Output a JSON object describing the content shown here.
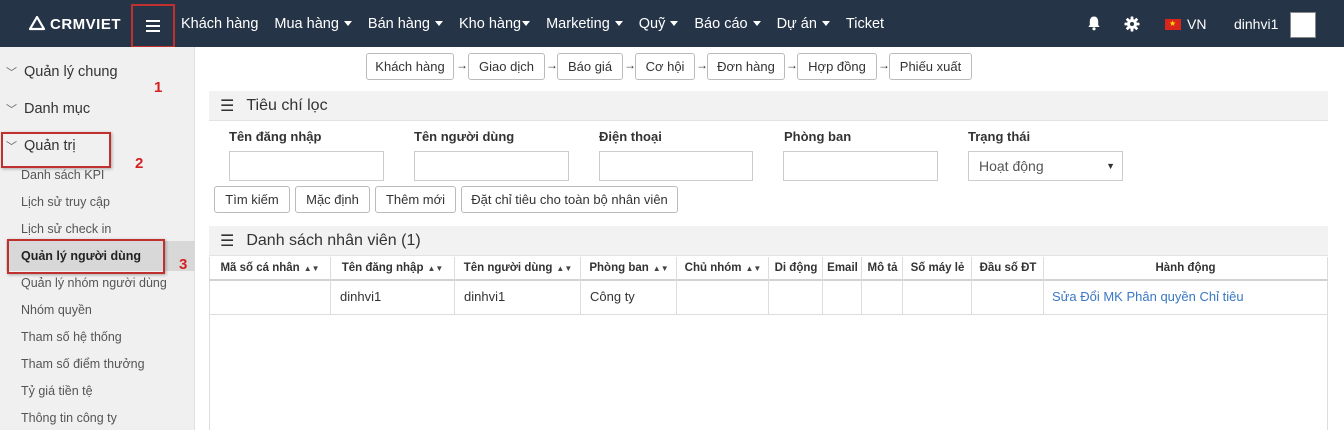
{
  "brand": {
    "name": "CRMVIET"
  },
  "nav": {
    "items": [
      {
        "label": "Khách hàng",
        "dropdown": false
      },
      {
        "label": "Mua hàng",
        "dropdown": true
      },
      {
        "label": "Bán hàng",
        "dropdown": true
      },
      {
        "label": "Kho hàng",
        "dropdown": true
      },
      {
        "label": "Marketing",
        "dropdown": true
      },
      {
        "label": "Quỹ",
        "dropdown": true
      },
      {
        "label": "Báo cáo",
        "dropdown": true
      },
      {
        "label": "Dự án",
        "dropdown": true
      },
      {
        "label": "Ticket",
        "dropdown": false
      }
    ],
    "language": "VN",
    "username": "dinhvi1"
  },
  "sidebar": {
    "groups": [
      {
        "label": "Quản lý chung"
      },
      {
        "label": "Danh mục"
      },
      {
        "label": "Quản trị"
      }
    ],
    "sub_items": [
      {
        "label": "Danh sách KPI"
      },
      {
        "label": "Lịch sử truy cập"
      },
      {
        "label": "Lịch sử check in"
      },
      {
        "label": "Quản lý người dùng",
        "active": true
      },
      {
        "label": "Quản lý nhóm người dùng"
      },
      {
        "label": "Nhóm quyền"
      },
      {
        "label": "Tham số hệ thống"
      },
      {
        "label": "Tham số điểm thưởng"
      },
      {
        "label": "Tỷ giá tiền tệ"
      },
      {
        "label": "Thông tin công ty"
      }
    ]
  },
  "annotations": [
    "1",
    "2",
    "3"
  ],
  "flow": [
    "Khách hàng",
    "Giao dịch",
    "Báo giá",
    "Cơ hội",
    "Đơn hàng",
    "Hợp đồng",
    "Phiếu xuất"
  ],
  "filter": {
    "title": "Tiêu chí lọc",
    "fields": {
      "username": "Tên đăng nhập",
      "fullname": "Tên người dùng",
      "phone": "Điện thoại",
      "department": "Phòng ban",
      "status": "Trạng thái"
    },
    "status_value": "Hoạt động",
    "buttons": {
      "search": "Tìm kiếm",
      "default": "Mặc định",
      "add": "Thêm mới",
      "set_target": "Đặt chỉ tiêu cho toàn bộ nhân viên"
    }
  },
  "list": {
    "title": "Danh sách nhân viên (1)",
    "columns": [
      {
        "label": "Mã số cá nhân",
        "sortable": true
      },
      {
        "label": "Tên đăng nhập",
        "sortable": true
      },
      {
        "label": "Tên người dùng",
        "sortable": true
      },
      {
        "label": "Phòng ban",
        "sortable": true
      },
      {
        "label": "Chủ nhóm",
        "sortable": true
      },
      {
        "label": "Di động",
        "sortable": false
      },
      {
        "label": "Email",
        "sortable": false
      },
      {
        "label": "Mô tả",
        "sortable": false
      },
      {
        "label": "Số máy lẻ",
        "sortable": false
      },
      {
        "label": "Đầu số ĐT",
        "sortable": false
      },
      {
        "label": "Hành động",
        "sortable": false
      }
    ],
    "rows": [
      {
        "personal_id": "",
        "username": "dinhvi1",
        "fullname": "dinhvi1",
        "department": "Công ty",
        "group_owner": "",
        "mobile": "",
        "email": "",
        "description": "",
        "extension": "",
        "prefix": "",
        "actions": [
          "Sửa",
          "Đổi MK",
          "Phân quyền",
          "Chỉ tiêu"
        ]
      }
    ]
  },
  "colors": {
    "navbar": "#253447",
    "annotation": "#c0302f",
    "link": "#3a78c3"
  }
}
